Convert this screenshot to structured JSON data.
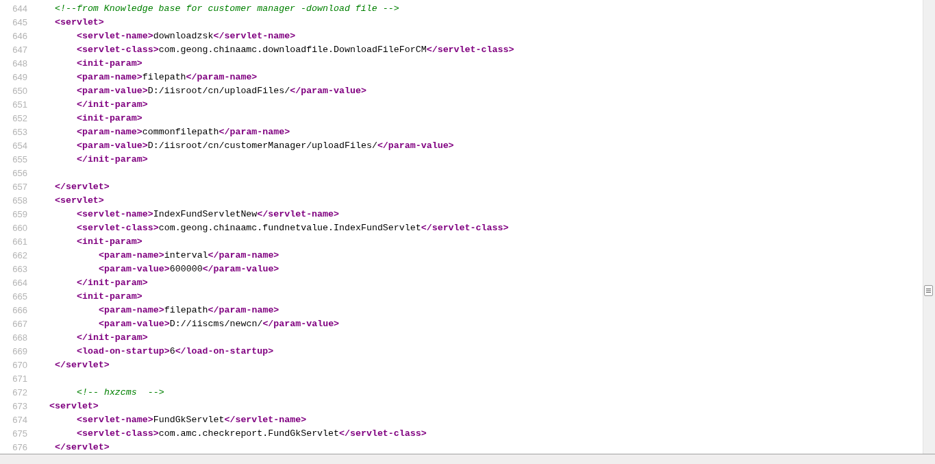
{
  "lines": [
    {
      "number": "644",
      "kind": "top",
      "segments": [
        {
          "kind": "comment",
          "text": "<!--from Knowledge base for customer manager -download file -->"
        }
      ]
    },
    {
      "number": "645",
      "kind": "top",
      "segments": [
        {
          "kind": "tag",
          "text": "<servlet>"
        }
      ]
    },
    {
      "number": "646",
      "kind": "inner",
      "segments": [
        {
          "kind": "tag",
          "text": "<servlet-name>"
        },
        {
          "kind": "text",
          "text": "downloadzsk"
        },
        {
          "kind": "tag",
          "text": "</servlet-name>"
        }
      ]
    },
    {
      "number": "647",
      "kind": "inner",
      "segments": [
        {
          "kind": "tag",
          "text": "<servlet-class>"
        },
        {
          "kind": "text",
          "text": "com.geong.chinaamc.downloadfile.DownloadFileForCM"
        },
        {
          "kind": "tag",
          "text": "</servlet-class>"
        }
      ]
    },
    {
      "number": "648",
      "kind": "inner",
      "segments": [
        {
          "kind": "tag",
          "text": "<init-param>"
        }
      ]
    },
    {
      "number": "649",
      "kind": "inner",
      "segments": [
        {
          "kind": "tag",
          "text": "<param-name>"
        },
        {
          "kind": "text",
          "text": "filepath"
        },
        {
          "kind": "tag",
          "text": "</param-name>"
        }
      ]
    },
    {
      "number": "650",
      "kind": "inner",
      "segments": [
        {
          "kind": "tag",
          "text": "<param-value>"
        },
        {
          "kind": "text",
          "text": "D:/iisroot/cn/uploadFiles/"
        },
        {
          "kind": "tag",
          "text": "</param-value>"
        }
      ]
    },
    {
      "number": "651",
      "kind": "inner",
      "segments": [
        {
          "kind": "tag",
          "text": "</init-param>"
        }
      ]
    },
    {
      "number": "652",
      "kind": "inner",
      "segments": [
        {
          "kind": "tag",
          "text": "<init-param>"
        }
      ]
    },
    {
      "number": "653",
      "kind": "inner",
      "segments": [
        {
          "kind": "tag",
          "text": "<param-name>"
        },
        {
          "kind": "text",
          "text": "commonfilepath"
        },
        {
          "kind": "tag",
          "text": "</param-name>"
        }
      ]
    },
    {
      "number": "654",
      "kind": "inner",
      "segments": [
        {
          "kind": "tag",
          "text": "<param-value>"
        },
        {
          "kind": "text",
          "text": "D:/iisroot/cn/customerManager/uploadFiles/"
        },
        {
          "kind": "tag",
          "text": "</param-value>"
        }
      ]
    },
    {
      "number": "655",
      "kind": "inner",
      "segments": [
        {
          "kind": "tag",
          "text": "</init-param>"
        }
      ]
    },
    {
      "number": "656",
      "kind": "blank"
    },
    {
      "number": "657",
      "kind": "top",
      "segments": [
        {
          "kind": "tag",
          "text": "</servlet>"
        }
      ]
    },
    {
      "number": "658",
      "kind": "top",
      "segments": [
        {
          "kind": "tag",
          "text": "<servlet>"
        }
      ]
    },
    {
      "number": "659",
      "kind": "inner",
      "segments": [
        {
          "kind": "tag",
          "text": "<servlet-name>"
        },
        {
          "kind": "text",
          "text": "IndexFundServletNew"
        },
        {
          "kind": "tag",
          "text": "</servlet-name>"
        }
      ]
    },
    {
      "number": "660",
      "kind": "inner",
      "segments": [
        {
          "kind": "tag",
          "text": "<servlet-class>"
        },
        {
          "kind": "text",
          "text": "com.geong.chinaamc.fundnetvalue.IndexFundServlet"
        },
        {
          "kind": "tag",
          "text": "</servlet-class>"
        }
      ]
    },
    {
      "number": "661",
      "kind": "inner",
      "segments": [
        {
          "kind": "tag",
          "text": "<init-param>"
        }
      ]
    },
    {
      "number": "662",
      "kind": "deep",
      "segments": [
        {
          "kind": "tag",
          "text": "<param-name>"
        },
        {
          "kind": "text",
          "text": "interval"
        },
        {
          "kind": "tag",
          "text": "</param-name>"
        }
      ]
    },
    {
      "number": "663",
      "kind": "deep",
      "segments": [
        {
          "kind": "tag",
          "text": "<param-value>"
        },
        {
          "kind": "text",
          "text": "600000"
        },
        {
          "kind": "tag",
          "text": "</param-value>"
        }
      ]
    },
    {
      "number": "664",
      "kind": "inner",
      "segments": [
        {
          "kind": "tag",
          "text": "</init-param>"
        }
      ]
    },
    {
      "number": "665",
      "kind": "inner",
      "segments": [
        {
          "kind": "tag",
          "text": "<init-param>"
        }
      ]
    },
    {
      "number": "666",
      "kind": "deep",
      "segments": [
        {
          "kind": "tag",
          "text": "<param-name>"
        },
        {
          "kind": "text",
          "text": "filepath"
        },
        {
          "kind": "tag",
          "text": "</param-name>"
        }
      ]
    },
    {
      "number": "667",
      "kind": "deep",
      "segments": [
        {
          "kind": "tag",
          "text": "<param-value>"
        },
        {
          "kind": "text",
          "text": "D://iiscms/newcn/"
        },
        {
          "kind": "tag",
          "text": "</param-value>"
        }
      ]
    },
    {
      "number": "668",
      "kind": "inner",
      "segments": [
        {
          "kind": "tag",
          "text": "</init-param>"
        }
      ]
    },
    {
      "number": "669",
      "kind": "inner",
      "segments": [
        {
          "kind": "tag",
          "text": "<load-on-startup>"
        },
        {
          "kind": "text",
          "text": "6"
        },
        {
          "kind": "tag",
          "text": "</load-on-startup>"
        }
      ]
    },
    {
      "number": "670",
      "kind": "top",
      "segments": [
        {
          "kind": "tag",
          "text": "</servlet>"
        }
      ]
    },
    {
      "number": "671",
      "kind": "blank"
    },
    {
      "number": "672",
      "kind": "inner",
      "segments": [
        {
          "kind": "comment",
          "text": "<!-- hxzcms  -->"
        }
      ]
    },
    {
      "number": "673",
      "kind": "outer",
      "segments": [
        {
          "kind": "tag",
          "text": "<servlet>"
        }
      ]
    },
    {
      "number": "674",
      "kind": "inner",
      "segments": [
        {
          "kind": "tag",
          "text": "<servlet-name>"
        },
        {
          "kind": "text",
          "text": "FundGkServlet"
        },
        {
          "kind": "tag",
          "text": "</servlet-name>"
        }
      ]
    },
    {
      "number": "675",
      "kind": "inner",
      "segments": [
        {
          "kind": "tag",
          "text": "<servlet-class>"
        },
        {
          "kind": "text",
          "text": "com.amc.checkreport.FundGkServlet"
        },
        {
          "kind": "tag",
          "text": "</servlet-class>"
        }
      ]
    },
    {
      "number": "676",
      "kind": "top",
      "segments": [
        {
          "kind": "tag",
          "text": "</servlet>"
        }
      ]
    }
  ]
}
